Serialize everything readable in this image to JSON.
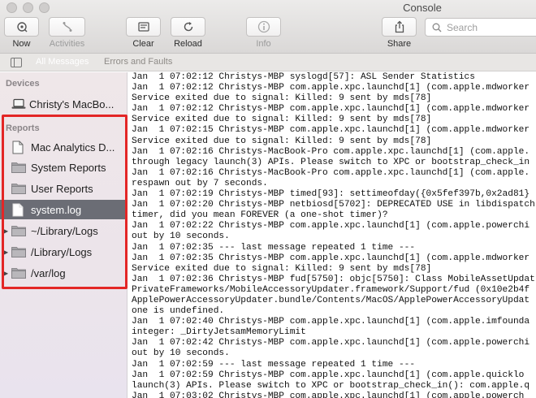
{
  "window": {
    "title": "Console"
  },
  "toolbar": {
    "now": "Now",
    "activities": "Activities",
    "clear": "Clear",
    "reload": "Reload",
    "info": "Info",
    "share": "Share",
    "search_placeholder": "Search"
  },
  "filters": {
    "all_messages": "All Messages",
    "errors_faults": "Errors and Faults"
  },
  "sidebar": {
    "devices_header": "Devices",
    "device": "Christy's MacBo...",
    "reports_header": "Reports",
    "items": [
      {
        "label": "Mac Analytics D...",
        "icon": "document-icon"
      },
      {
        "label": "System Reports",
        "icon": "folder-icon"
      },
      {
        "label": "User Reports",
        "icon": "folder-icon"
      },
      {
        "label": "system.log",
        "icon": "document-icon",
        "selected": true
      },
      {
        "label": "~/Library/Logs",
        "icon": "folder-icon",
        "disclosure": true
      },
      {
        "label": "/Library/Logs",
        "icon": "folder-icon",
        "disclosure": true
      },
      {
        "label": "/var/log",
        "icon": "folder-icon",
        "disclosure": true
      }
    ]
  },
  "log_lines": [
    "Jan  1 07:02:12 Christys-MBP syslogd[57]: ASL Sender Statistics",
    "Jan  1 07:02:12 Christys-MBP com.apple.xpc.launchd[1] (com.apple.mdworker",
    "Service exited due to signal: Killed: 9 sent by mds[78]",
    "Jan  1 07:02:12 Christys-MBP com.apple.xpc.launchd[1] (com.apple.mdworker",
    "Service exited due to signal: Killed: 9 sent by mds[78]",
    "Jan  1 07:02:15 Christys-MBP com.apple.xpc.launchd[1] (com.apple.mdworker",
    "Service exited due to signal: Killed: 9 sent by mds[78]",
    "Jan  1 07:02:16 Christys-MacBook-Pro com.apple.xpc.launchd[1] (com.apple.",
    "through legacy launch(3) APIs. Please switch to XPC or bootstrap_check_in",
    "Jan  1 07:02:16 Christys-MacBook-Pro com.apple.xpc.launchd[1] (com.apple.",
    "respawn out by 7 seconds.",
    "Jan  1 07:02:19 Christys-MBP timed[93]: settimeofday({0x5fef397b,0x2ad81}",
    "Jan  1 07:02:20 Christys-MBP netbiosd[5702]: DEPRECATED USE in libdispatch",
    "timer, did you mean FOREVER (a one-shot timer)?",
    "Jan  1 07:02:22 Christys-MBP com.apple.xpc.launchd[1] (com.apple.powerchi",
    "out by 10 seconds.",
    "Jan  1 07:02:35 --- last message repeated 1 time ---",
    "Jan  1 07:02:35 Christys-MBP com.apple.xpc.launchd[1] (com.apple.mdworker",
    "Service exited due to signal: Killed: 9 sent by mds[78]",
    "Jan  1 07:02:36 Christys-MBP fud[5750]: objc[5750]: Class MobileAssetUpdat",
    "PrivateFrameworks/MobileAccessoryUpdater.framework/Support/fud (0x10e2b4f",
    "ApplePowerAccessoryUpdater.bundle/Contents/MacOS/ApplePowerAccessoryUpdat",
    "one is undefined.",
    "Jan  1 07:02:40 Christys-MBP com.apple.xpc.launchd[1] (com.apple.imfounda",
    "integer: _DirtyJetsamMemoryLimit",
    "Jan  1 07:02:42 Christys-MBP com.apple.xpc.launchd[1] (com.apple.powerchi",
    "out by 10 seconds.",
    "Jan  1 07:02:59 --- last message repeated 1 time ---",
    "Jan  1 07:02:59 Christys-MBP com.apple.xpc.launchd[1] (com.apple.quicklo",
    "launch(3) APIs. Please switch to XPC or bootstrap_check_in(): com.apple.q",
    "Jan  1 07:03:02 Christys-MBP com.apple.xpc.launchd[1] (com.apple.powerch"
  ]
}
